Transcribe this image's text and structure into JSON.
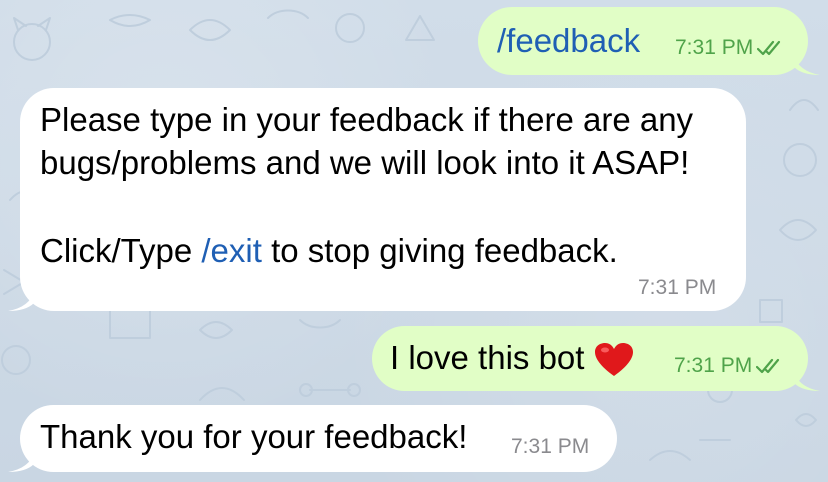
{
  "theme": {
    "background": "#cfdce8",
    "incoming_bubble": "#ffffff",
    "outgoing_bubble": "#e1fec6",
    "link_color": "#1f5fb4",
    "outgoing_meta_color": "#4fa34a",
    "incoming_meta_color": "#8a8a8e"
  },
  "messages": [
    {
      "direction": "outgoing",
      "text": "/feedback",
      "time": "7:31 PM",
      "status_icon": "double-check-icon"
    },
    {
      "direction": "incoming",
      "line1": "Please type in your feedback if there are any",
      "line2": "bugs/problems and we will look into it ASAP!",
      "line3_prefix": "Click/Type ",
      "line3_command": "/exit",
      "line3_suffix": " to stop giving feedback.",
      "time": "7:31 PM"
    },
    {
      "direction": "outgoing",
      "text": "I love this bot",
      "emoji": "red-heart-icon",
      "time": "7:31 PM",
      "status_icon": "double-check-icon"
    },
    {
      "direction": "incoming",
      "text": "Thank you for your feedback!",
      "time": "7:31 PM"
    }
  ]
}
